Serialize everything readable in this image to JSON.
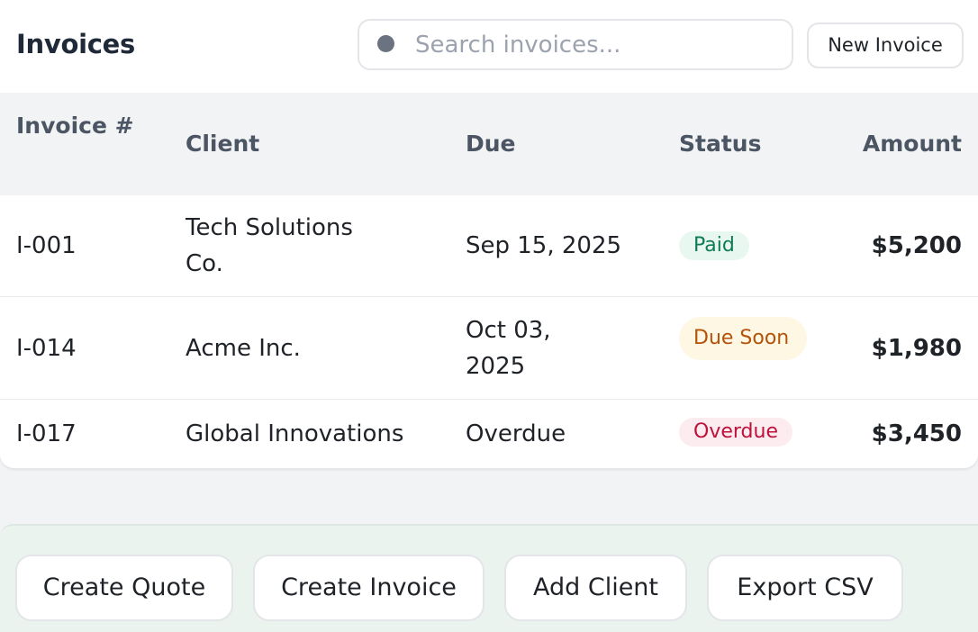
{
  "header": {
    "title": "Invoices",
    "search_placeholder": "Search invoices...",
    "new_button": "New Invoice"
  },
  "table": {
    "columns": [
      "Invoice #",
      "Client",
      "Due",
      "Status",
      "Amount"
    ],
    "rows": [
      {
        "invoice": "I-001",
        "client": "Tech Solutions Co.",
        "due": "Sep 15, 2025",
        "status": "Paid",
        "amount": "$5,200"
      },
      {
        "invoice": "I-014",
        "client": "Acme Inc.",
        "due": "Oct 03, 2025",
        "status": "Due Soon",
        "amount": "$1,980"
      },
      {
        "invoice": "I-017",
        "client": "Global Innovations",
        "due": "Overdue",
        "status": "Overdue",
        "amount": "$3,450"
      }
    ]
  },
  "status_colors": {
    "paid": {
      "bg": "#e8f8f1",
      "fg": "#0f7a55"
    },
    "due_soon": {
      "bg": "#fdf7e4",
      "fg": "#b45309"
    },
    "overdue": {
      "bg": "#fdecef",
      "fg": "#be123c"
    }
  },
  "actions": {
    "create_quote": "Create Quote",
    "create_invoice": "Create Invoice",
    "add_client": "Add Client",
    "export_csv": "Export CSV"
  }
}
